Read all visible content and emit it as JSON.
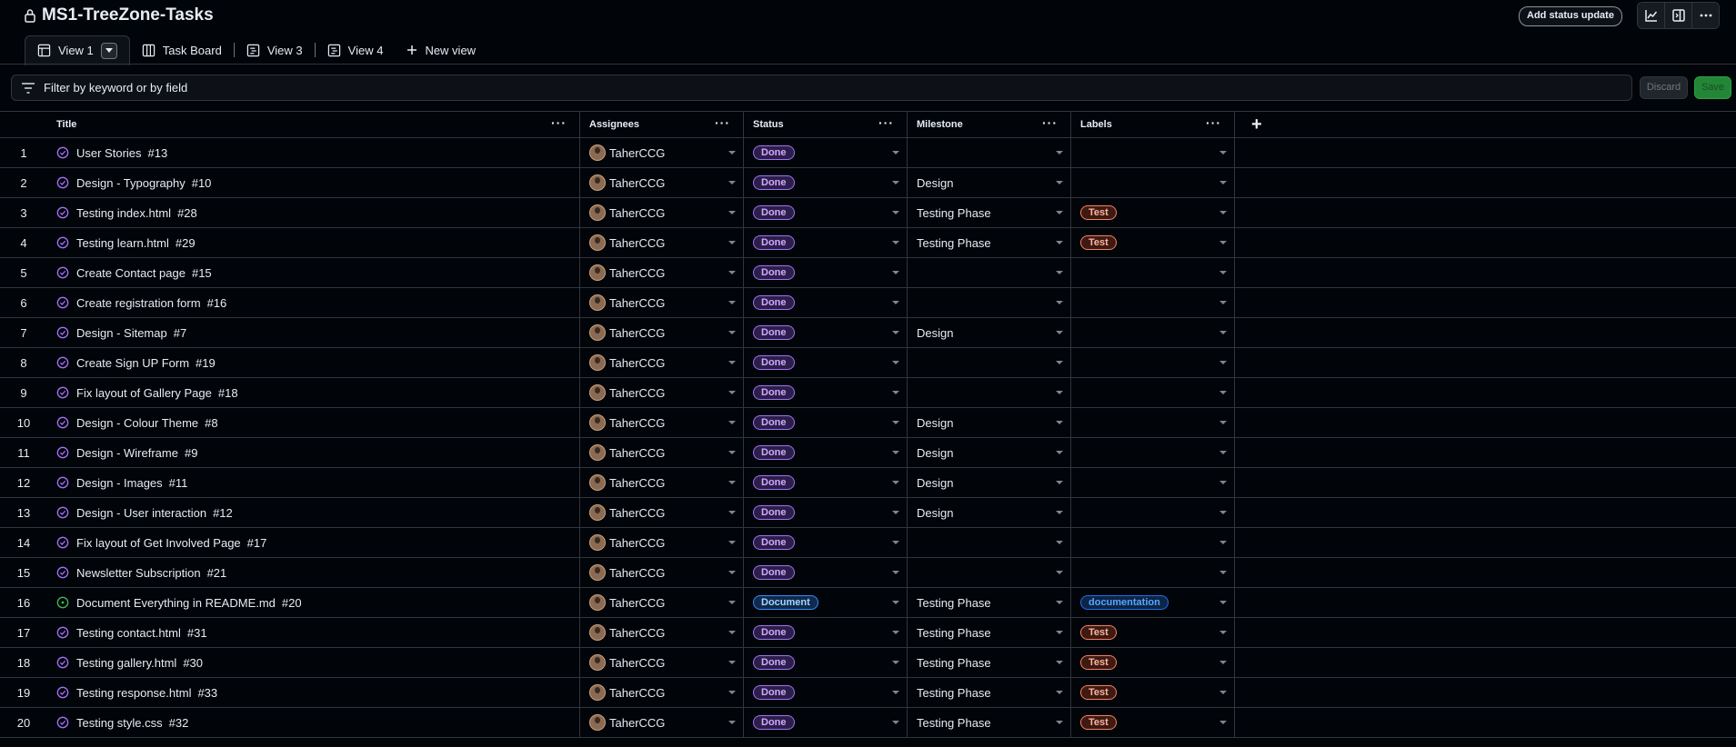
{
  "project": {
    "title": "MS1-TreeZone-Tasks"
  },
  "header": {
    "status_button": "Add status update",
    "icons": [
      "chart-icon",
      "panel-icon",
      "more-icon"
    ]
  },
  "tabs": [
    {
      "label": "View 1",
      "icon": "table-icon",
      "active": true
    },
    {
      "label": "Task Board",
      "icon": "board-icon",
      "active": false
    },
    {
      "label": "View 3",
      "icon": "roadmap-icon",
      "active": false
    },
    {
      "label": "View 4",
      "icon": "roadmap-icon",
      "active": false
    }
  ],
  "new_view_label": "New view",
  "filter": {
    "placeholder": "Filter by keyword or by field"
  },
  "buttons": {
    "discard": "Discard",
    "save": "Save"
  },
  "columns": {
    "title": "Title",
    "assignees": "Assignees",
    "status": "Status",
    "milestone": "Milestone",
    "labels": "Labels"
  },
  "colors": {
    "closed_icon": "#a371f7",
    "open_icon": "#3fb950",
    "test_label": "#f78166",
    "documentation_label": "#1f6feb"
  },
  "rows": [
    {
      "n": "1",
      "title": "User Stories",
      "issue": "#13",
      "state": "closed",
      "assignee": "TaherCCG",
      "status": "Done",
      "milestone": "",
      "label": ""
    },
    {
      "n": "2",
      "title": "Design - Typography",
      "issue": "#10",
      "state": "closed",
      "assignee": "TaherCCG",
      "status": "Done",
      "milestone": "Design",
      "label": ""
    },
    {
      "n": "3",
      "title": "Testing index.html",
      "issue": "#28",
      "state": "closed",
      "assignee": "TaherCCG",
      "status": "Done",
      "milestone": "Testing Phase",
      "label": "Test"
    },
    {
      "n": "4",
      "title": "Testing learn.html",
      "issue": "#29",
      "state": "closed",
      "assignee": "TaherCCG",
      "status": "Done",
      "milestone": "Testing Phase",
      "label": "Test"
    },
    {
      "n": "5",
      "title": "Create Contact page",
      "issue": "#15",
      "state": "closed",
      "assignee": "TaherCCG",
      "status": "Done",
      "milestone": "",
      "label": ""
    },
    {
      "n": "6",
      "title": "Create registration form",
      "issue": "#16",
      "state": "closed",
      "assignee": "TaherCCG",
      "status": "Done",
      "milestone": "",
      "label": ""
    },
    {
      "n": "7",
      "title": "Design - Sitemap",
      "issue": "#7",
      "state": "closed",
      "assignee": "TaherCCG",
      "status": "Done",
      "milestone": "Design",
      "label": ""
    },
    {
      "n": "8",
      "title": "Create Sign UP Form",
      "issue": "#19",
      "state": "closed",
      "assignee": "TaherCCG",
      "status": "Done",
      "milestone": "",
      "label": ""
    },
    {
      "n": "9",
      "title": "Fix layout of Gallery Page",
      "issue": "#18",
      "state": "closed",
      "assignee": "TaherCCG",
      "status": "Done",
      "milestone": "",
      "label": ""
    },
    {
      "n": "10",
      "title": "Design - Colour Theme",
      "issue": "#8",
      "state": "closed",
      "assignee": "TaherCCG",
      "status": "Done",
      "milestone": "Design",
      "label": ""
    },
    {
      "n": "11",
      "title": "Design - Wireframe",
      "issue": "#9",
      "state": "closed",
      "assignee": "TaherCCG",
      "status": "Done",
      "milestone": "Design",
      "label": ""
    },
    {
      "n": "12",
      "title": "Design - Images",
      "issue": "#11",
      "state": "closed",
      "assignee": "TaherCCG",
      "status": "Done",
      "milestone": "Design",
      "label": ""
    },
    {
      "n": "13",
      "title": "Design - User interaction",
      "issue": "#12",
      "state": "closed",
      "assignee": "TaherCCG",
      "status": "Done",
      "milestone": "Design",
      "label": ""
    },
    {
      "n": "14",
      "title": "Fix layout of Get Involved Page",
      "issue": "#17",
      "state": "closed",
      "assignee": "TaherCCG",
      "status": "Done",
      "milestone": "",
      "label": ""
    },
    {
      "n": "15",
      "title": "Newsletter Subscription",
      "issue": "#21",
      "state": "closed",
      "assignee": "TaherCCG",
      "status": "Done",
      "milestone": "",
      "label": ""
    },
    {
      "n": "16",
      "title": "Document Everything in README.md",
      "issue": "#20",
      "state": "open",
      "assignee": "TaherCCG",
      "status": "Document",
      "milestone": "Testing Phase",
      "label": "documentation"
    },
    {
      "n": "17",
      "title": "Testing contact.html",
      "issue": "#31",
      "state": "closed",
      "assignee": "TaherCCG",
      "status": "Done",
      "milestone": "Testing Phase",
      "label": "Test"
    },
    {
      "n": "18",
      "title": "Testing gallery.html",
      "issue": "#30",
      "state": "closed",
      "assignee": "TaherCCG",
      "status": "Done",
      "milestone": "Testing Phase",
      "label": "Test"
    },
    {
      "n": "19",
      "title": "Testing response.html",
      "issue": "#33",
      "state": "closed",
      "assignee": "TaherCCG",
      "status": "Done",
      "milestone": "Testing Phase",
      "label": "Test"
    },
    {
      "n": "20",
      "title": "Testing style.css",
      "issue": "#32",
      "state": "closed",
      "assignee": "TaherCCG",
      "status": "Done",
      "milestone": "Testing Phase",
      "label": "Test"
    }
  ]
}
